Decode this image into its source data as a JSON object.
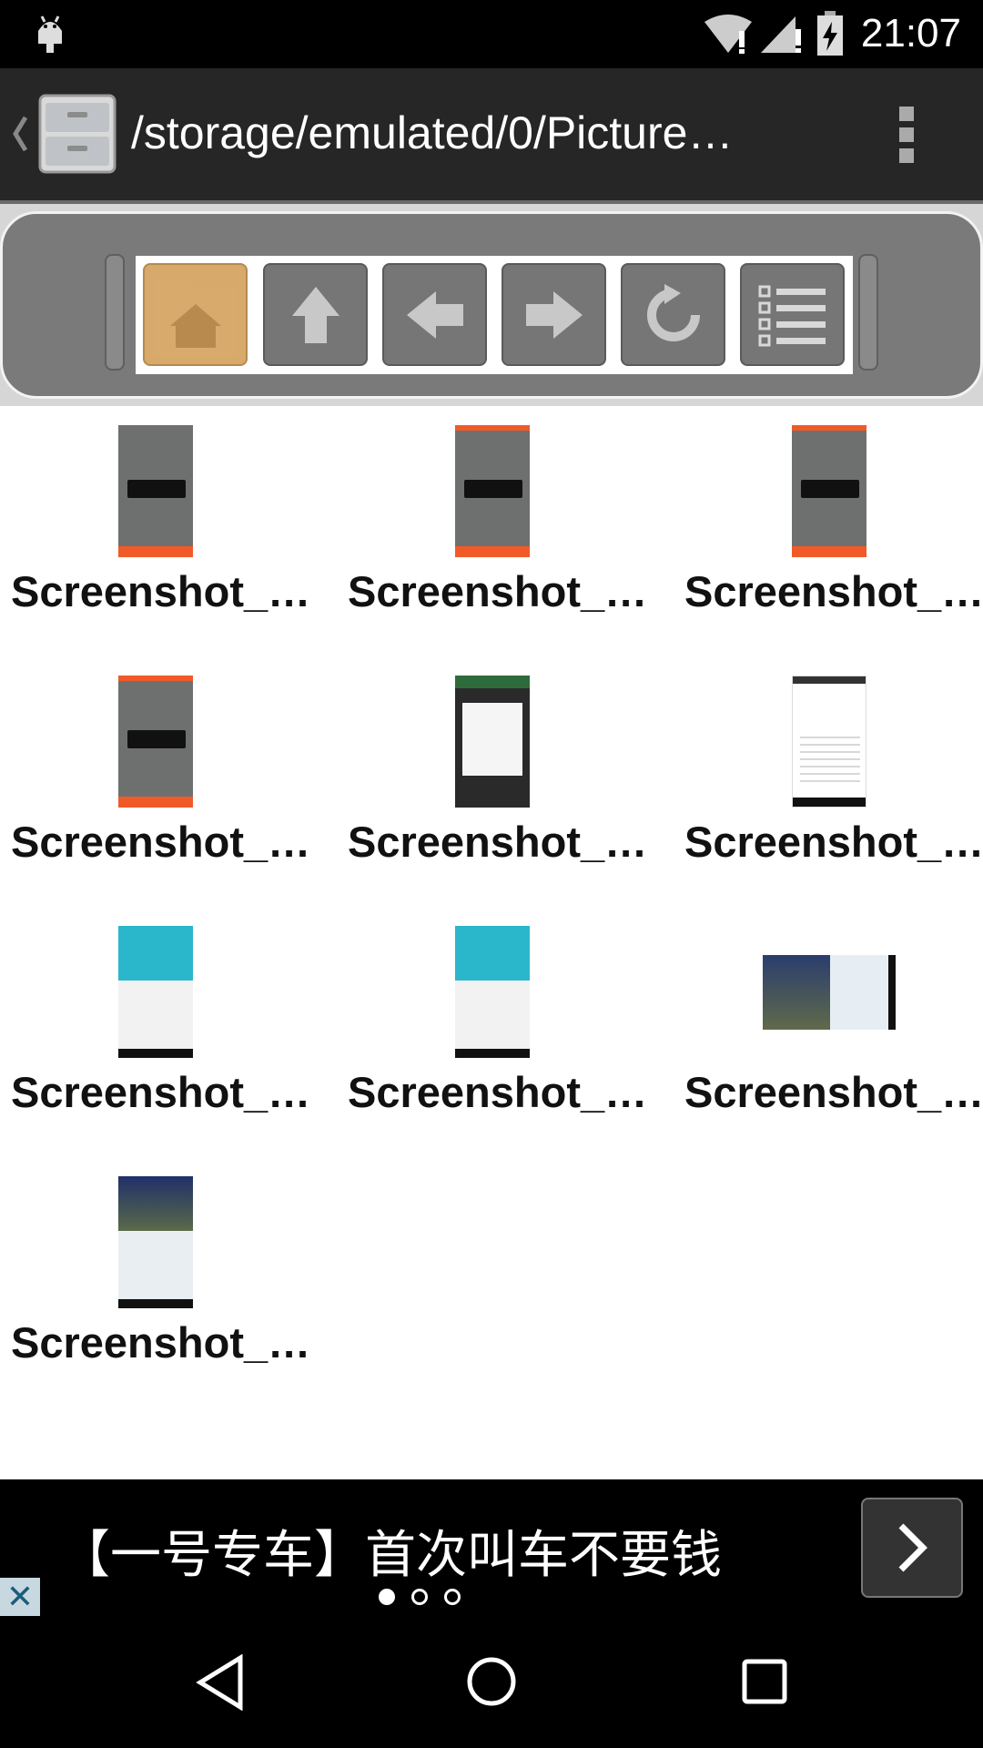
{
  "status_bar": {
    "time": "21:07"
  },
  "header": {
    "path": "/storage/emulated/0/Picture…"
  },
  "toolbar": {
    "buttons": [
      "home-folder",
      "up",
      "back",
      "forward",
      "refresh",
      "list-view"
    ]
  },
  "files": [
    {
      "name": "Screenshot_…",
      "thumb": "dark-app"
    },
    {
      "name": "Screenshot_…",
      "thumb": "dark-app"
    },
    {
      "name": "Screenshot_…",
      "thumb": "dark-app"
    },
    {
      "name": "Screenshot_…",
      "thumb": "dark-app"
    },
    {
      "name": "Screenshot_…",
      "thumb": "dialog"
    },
    {
      "name": "Screenshot_…",
      "thumb": "settings-list"
    },
    {
      "name": "Screenshot_…",
      "thumb": "system-update"
    },
    {
      "name": "Screenshot_…",
      "thumb": "system-update"
    },
    {
      "name": "Screenshot_…",
      "thumb": "navigation-landscape"
    },
    {
      "name": "Screenshot_…",
      "thumb": "navigation-portrait"
    }
  ],
  "ad": {
    "text": "【一号专车】首次叫车不要钱",
    "page_indicator": {
      "current": 1,
      "total": 3
    }
  },
  "colors": {
    "accent": "#f05a28",
    "toolbar": "#7a7a7a",
    "background": "#ffffff"
  }
}
